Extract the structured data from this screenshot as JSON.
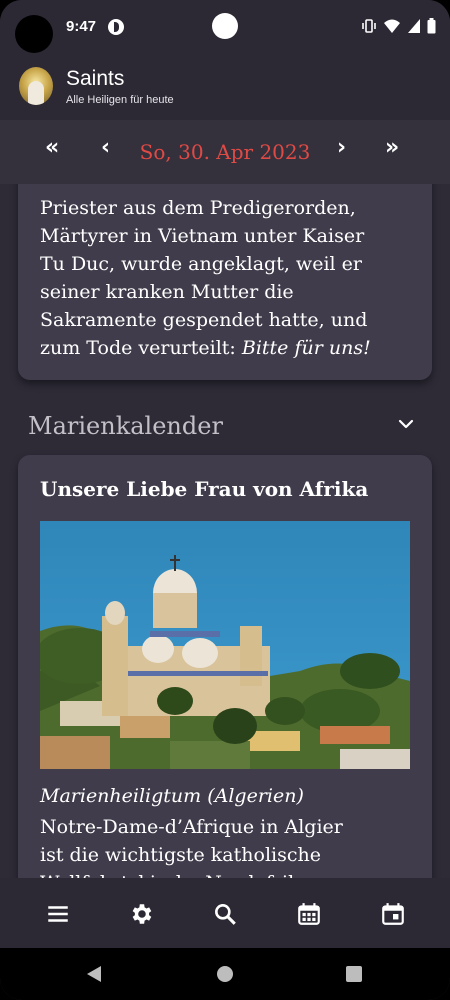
{
  "status_bar": {
    "time": "9:47"
  },
  "app_bar": {
    "title": "Saints",
    "subtitle": "Alle Heiligen für heute"
  },
  "date_nav": {
    "date": "So, 30. Apr 2023",
    "first_label": "«",
    "prev_label": "‹",
    "next_label": "›",
    "last_label": "»",
    "date_color": "#e04a45"
  },
  "saint_card": {
    "text_lines": [
      "Priester aus dem Predigerorden,",
      "Märtyrer in Vietnam unter Kaiser",
      "Tu Duc, wurde angeklagt, weil er",
      "seiner kranken Mutter die",
      "Sakramente gespendet hatte, und"
    ],
    "last_line_prefix": "zum Tode verurteilt: ",
    "last_line_italic": "Bitte für uns!"
  },
  "mary_section": {
    "heading": "Marienkalender",
    "card_title": "Unsere Liebe Frau von Afrika",
    "subtitle": "Marienheiligtum (Algerien)",
    "description_lines": [
      "Notre-Dame-d’Afrique in Algier",
      "ist die wichtigste katholische",
      "Wallfahrtskirche Nordafrikas"
    ]
  },
  "bottom_nav": {
    "items": [
      "menu-icon",
      "settings-icon",
      "search-icon",
      "calendar-month-icon",
      "calendar-today-icon"
    ]
  },
  "colors": {
    "background": "#2e2b37",
    "card": "#403c4b",
    "accent_date": "#e04a45"
  }
}
